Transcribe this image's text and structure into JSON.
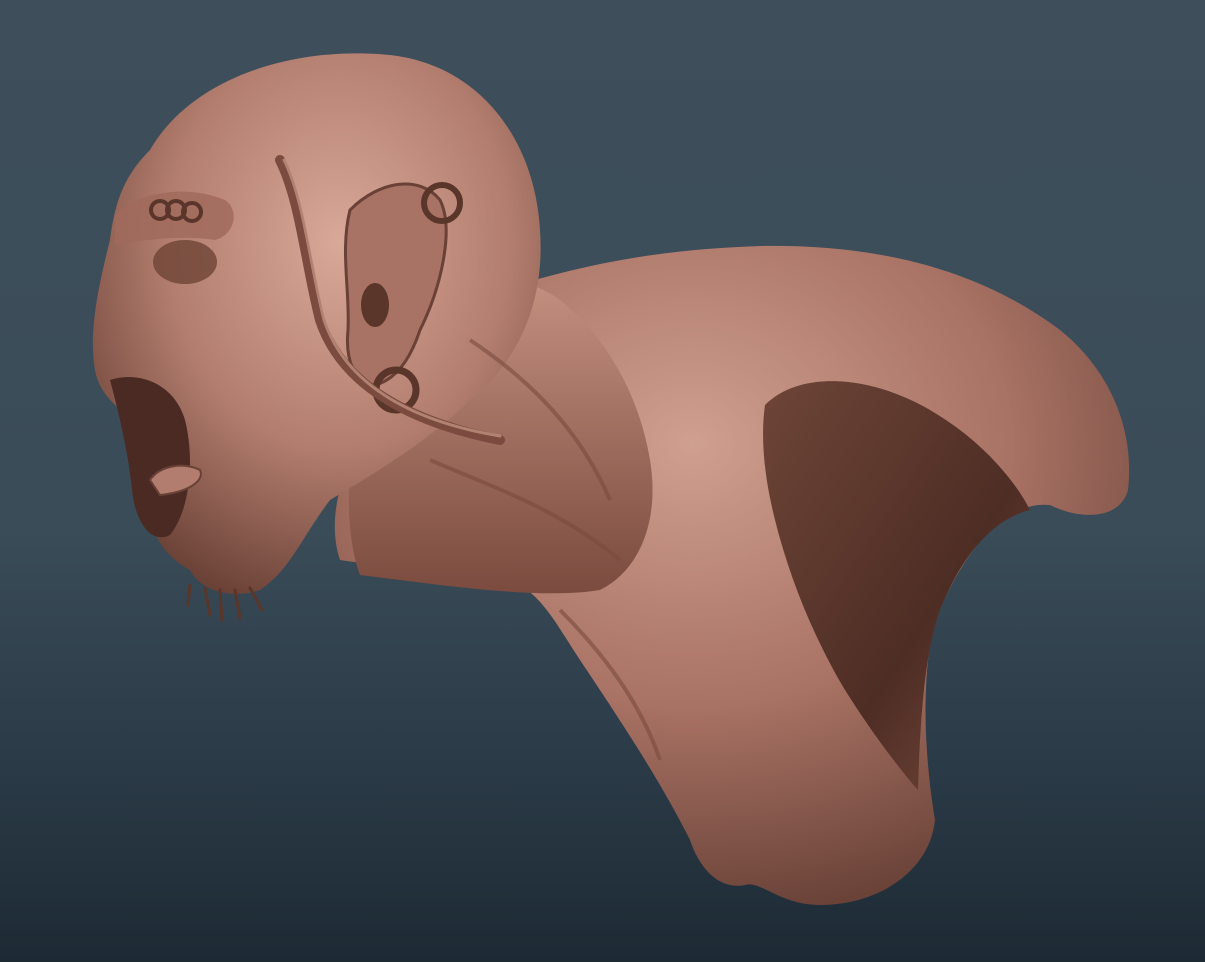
{
  "scene": {
    "subject": "",
    "background_top_color": "#3e4f5b",
    "background_bottom_color": "#1d2a34",
    "material_color": "#b27d6e",
    "material_shadow_color": "#5e3a31",
    "material_highlight_color": "#d9a898"
  }
}
